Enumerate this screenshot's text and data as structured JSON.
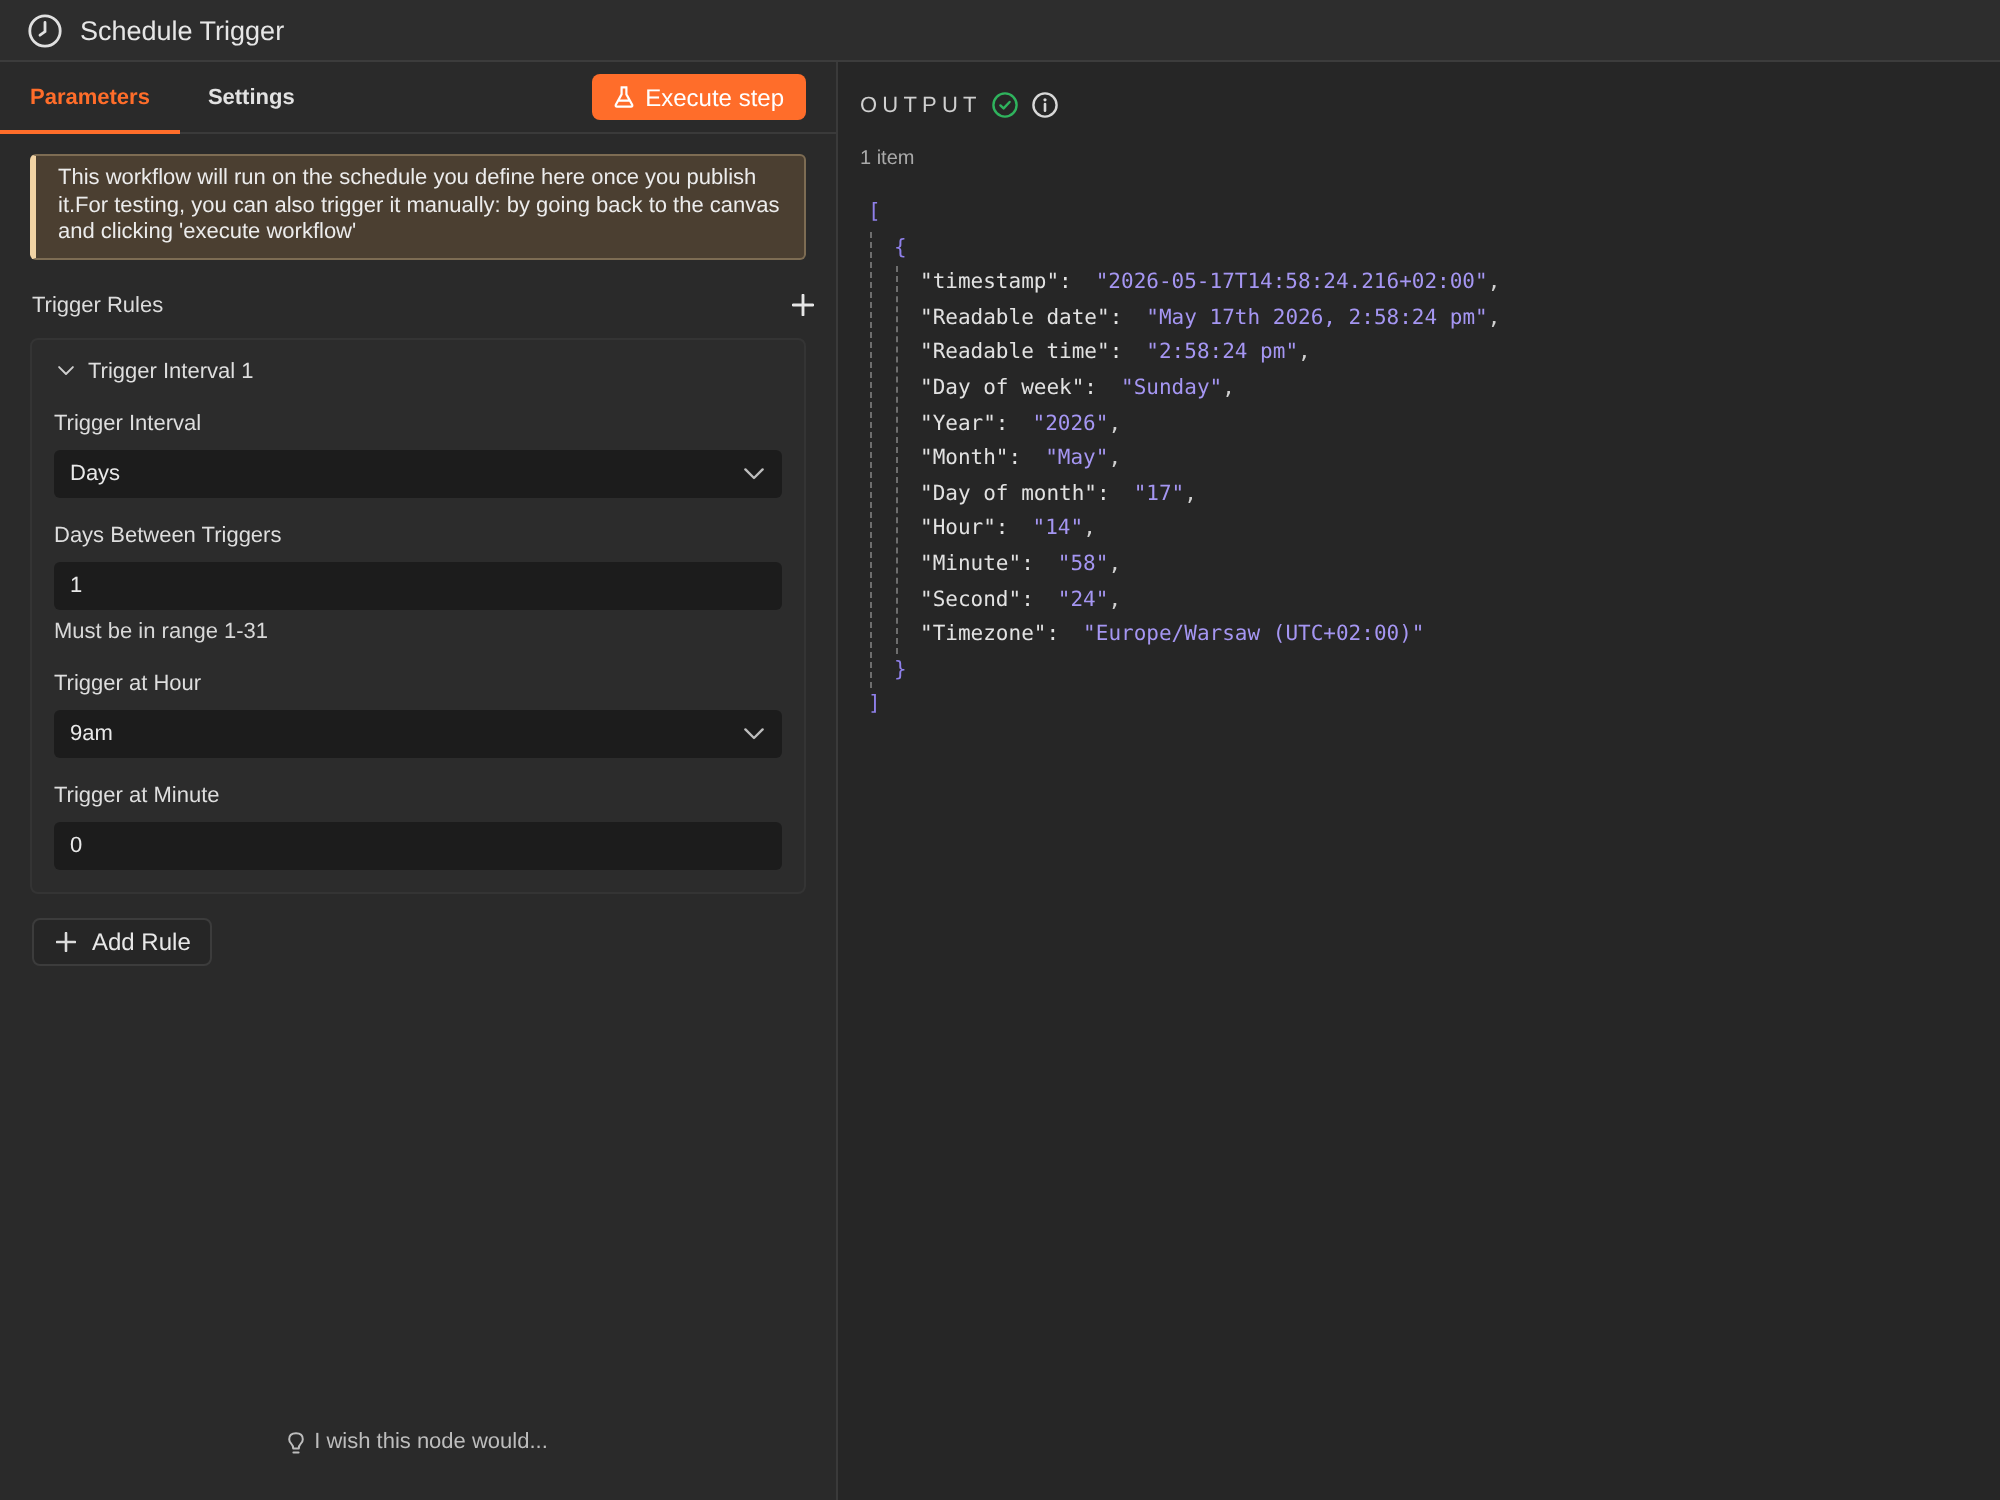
{
  "header": {
    "title": "Schedule Trigger"
  },
  "parameters_panel": {
    "tabs": [
      {
        "label": "Parameters",
        "selected": true
      },
      {
        "label": "Settings",
        "selected": false
      }
    ],
    "execute_button": {
      "label": "Execute step"
    },
    "notice": {
      "text": "This workflow will run on the schedule you define here once you publish it.For testing, you can also trigger it manually: by going back to the canvas and clicking 'execute workflow'"
    },
    "trigger_rules": {
      "label": "Trigger Rules",
      "rules": [
        {
          "title": "Trigger Interval 1",
          "expanded": true,
          "fields": [
            {
              "kind": "select",
              "label": "Trigger Interval",
              "value": "Days"
            },
            {
              "kind": "input",
              "label": "Days Between Triggers",
              "value": "1",
              "hint": "Must be in range 1-31"
            },
            {
              "kind": "select",
              "label": "Trigger at Hour",
              "value": "9am"
            },
            {
              "kind": "input",
              "label": "Trigger at Minute",
              "value": "0"
            }
          ]
        }
      ]
    },
    "add_rule_button": {
      "label": "Add Rule"
    },
    "feedback_link": {
      "label": "I wish this node would..."
    }
  },
  "output": {
    "title": "OUTPUT",
    "success": true,
    "count": "1 item",
    "json": {
      "open": "[",
      "close": "]",
      "items": [
        {
          "open": "{",
          "close": "}",
          "entries": [
            {
              "key": "\"timestamp\":",
              "value": "\"2026-05-17T14:58:24.216+02:00\"",
              "trail": ","
            },
            {
              "key": "\"Readable date\":",
              "value": "\"May 17th 2026, 2:58:24 pm\"",
              "trail": ","
            },
            {
              "key": "\"Readable time\":",
              "value": "\"2:58:24 pm\"",
              "trail": ","
            },
            {
              "key": "\"Day of week\":",
              "value": "\"Sunday\"",
              "trail": ","
            },
            {
              "key": "\"Year\":",
              "value": "\"2026\"",
              "trail": ","
            },
            {
              "key": "\"Month\":",
              "value": "\"May\"",
              "trail": ","
            },
            {
              "key": "\"Day of month\":",
              "value": "\"17\"",
              "trail": ","
            },
            {
              "key": "\"Hour\":",
              "value": "\"14\"",
              "trail": ","
            },
            {
              "key": "\"Minute\":",
              "value": "\"58\"",
              "trail": ","
            },
            {
              "key": "\"Second\":",
              "value": "\"24\"",
              "trail": ","
            },
            {
              "key": "\"Timezone\":",
              "value": "\"Europe/Warsaw (UTC+02:00)\""
            }
          ]
        }
      ]
    }
  }
}
